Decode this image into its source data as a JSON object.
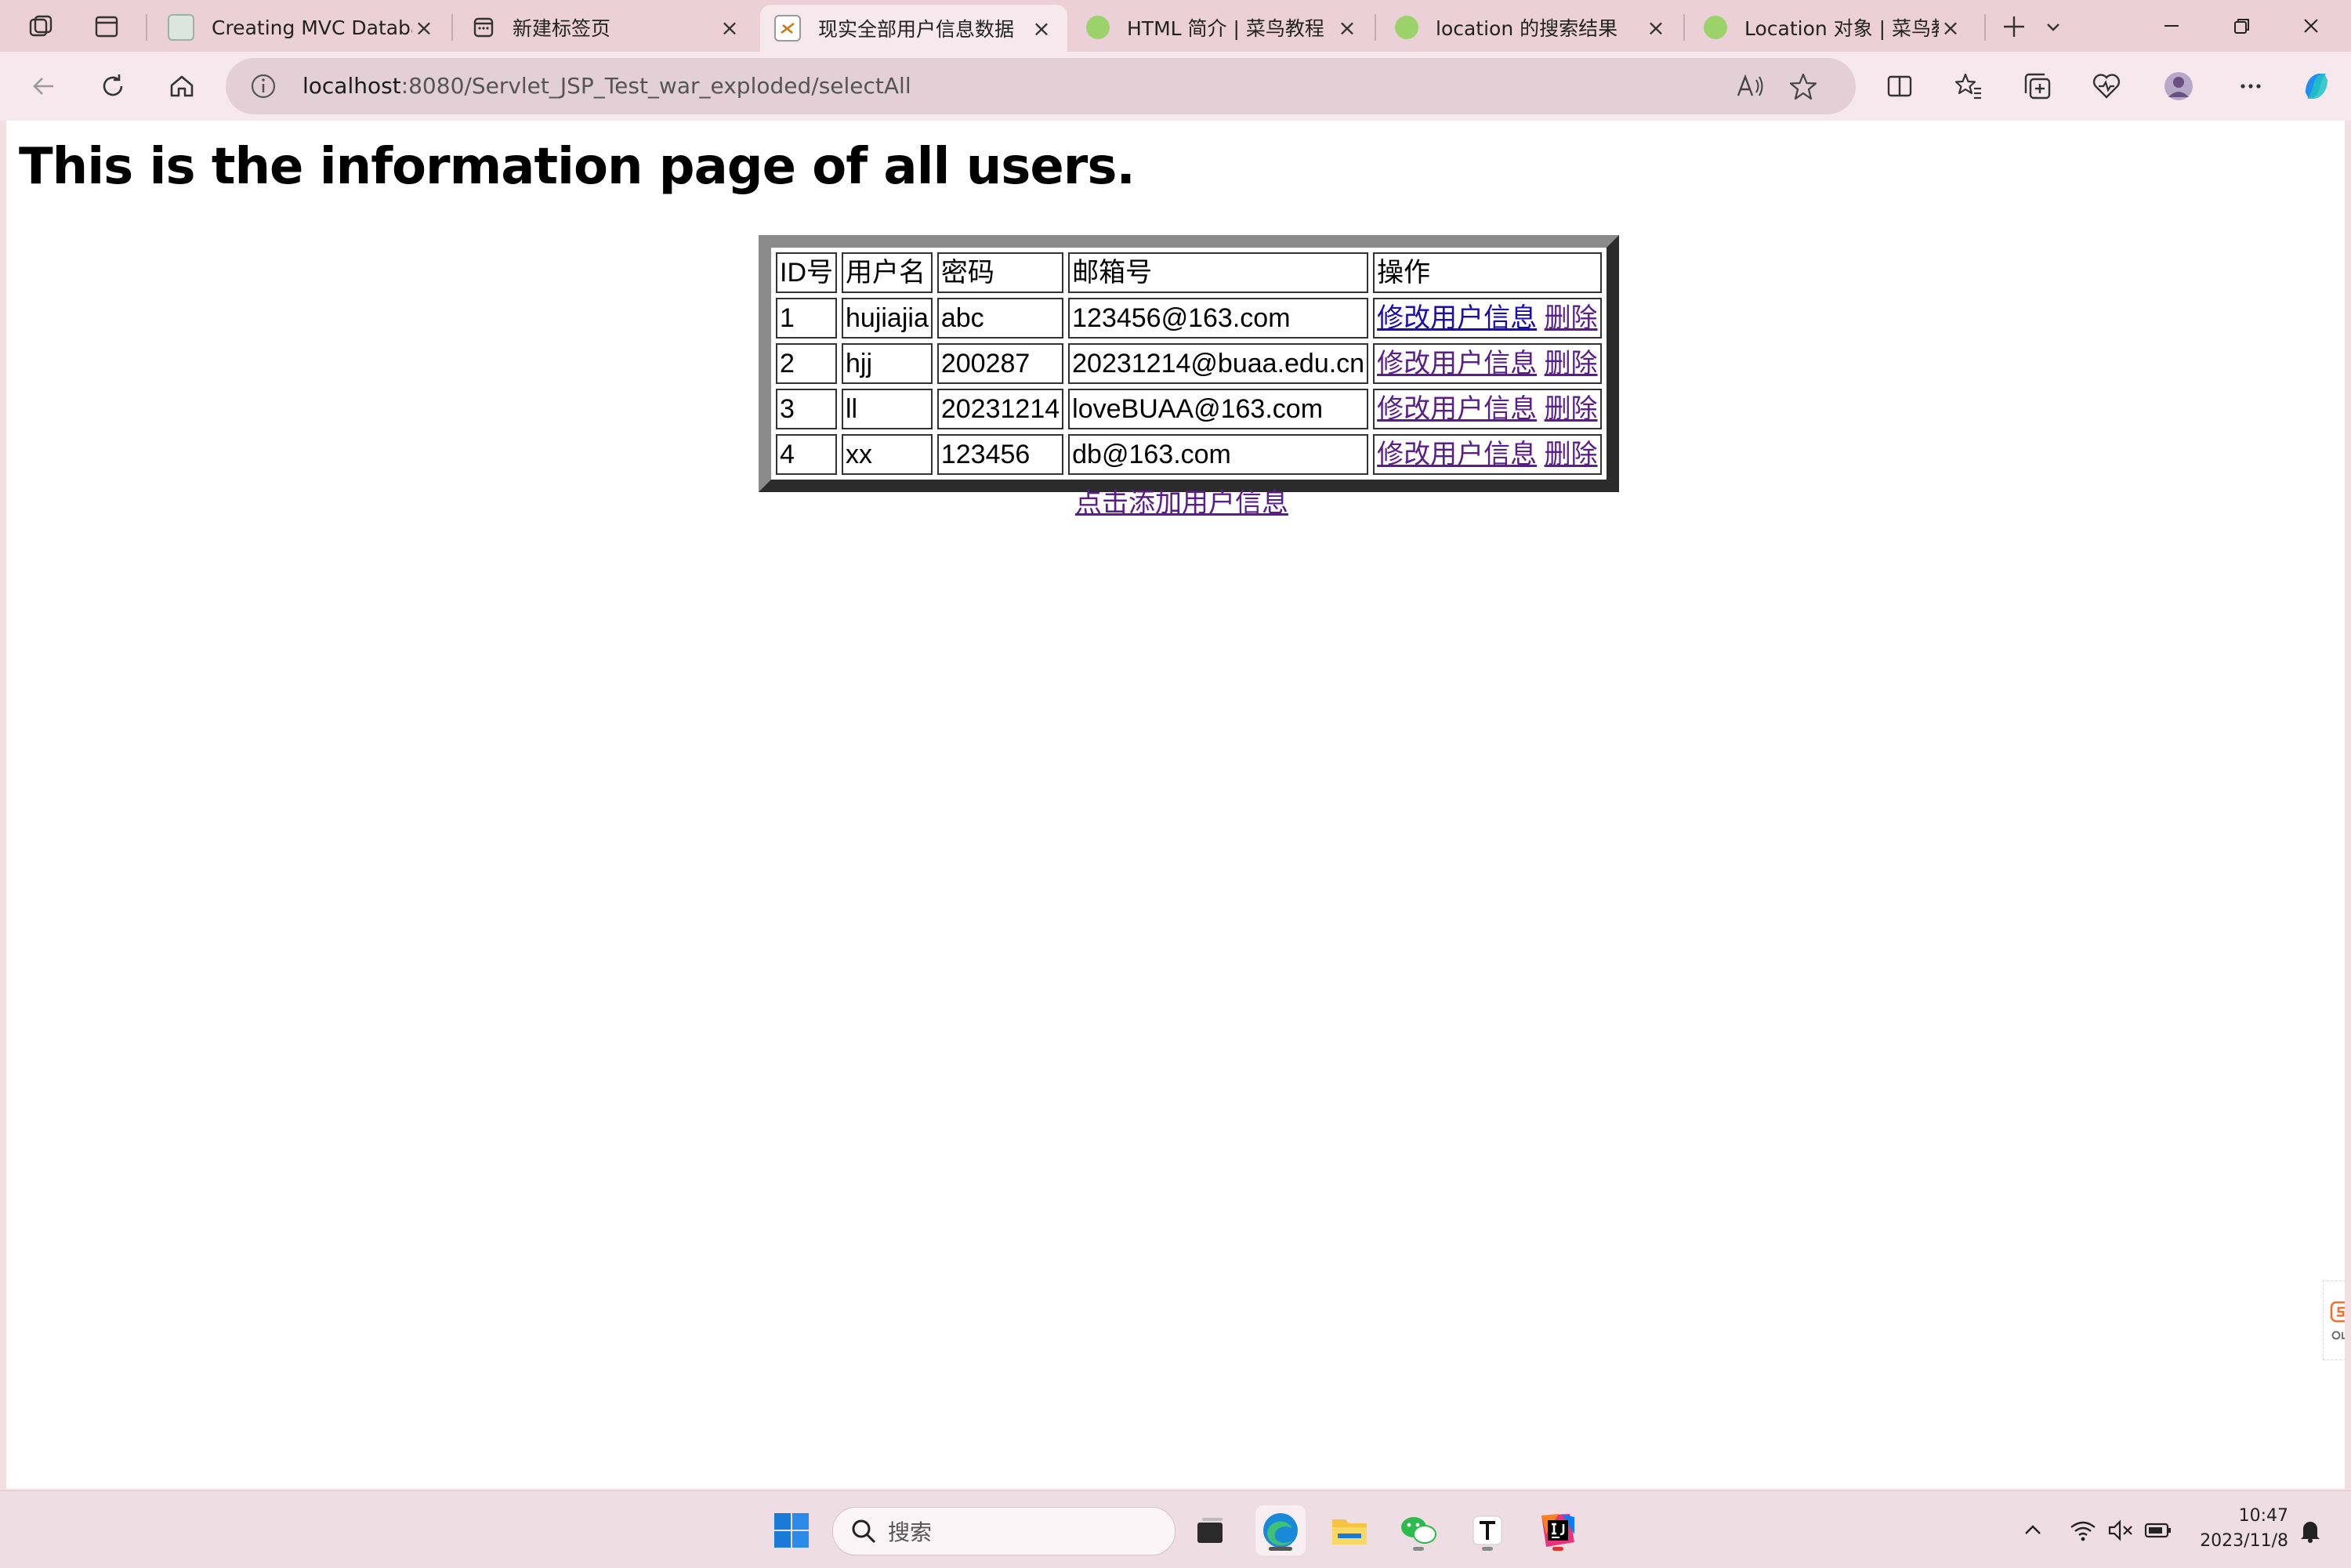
{
  "browser": {
    "tabs": [
      {
        "title": "Creating MVC Database W",
        "favicon": "app-icon"
      },
      {
        "title": "新建标签页",
        "favicon": "newtab-icon"
      },
      {
        "title": "现实全部用户信息数据",
        "favicon": "java-icon",
        "active": true
      },
      {
        "title": "HTML 简介 | 菜鸟教程",
        "favicon": "runoob-icon"
      },
      {
        "title": "location 的搜索结果",
        "favicon": "runoob-icon"
      },
      {
        "title": "Location 对象 | 菜鸟教程",
        "favicon": "runoob-icon"
      }
    ],
    "url_host": "localhost",
    "url_rest": ":8080/Servlet_JSP_Test_war_exploded/selectAll",
    "accent": "#1a0dab"
  },
  "page": {
    "title": "This is the information page of all users.",
    "table": {
      "headers": [
        "ID号",
        "用户名",
        "密码",
        "邮箱号",
        "操作"
      ],
      "rows": [
        {
          "id": "1",
          "username": "hujiajia",
          "password": "abc",
          "email": "123456@163.com"
        },
        {
          "id": "2",
          "username": "hjj",
          "password": "200287",
          "email": "20231214@buaa.edu.cn"
        },
        {
          "id": "3",
          "username": "ll",
          "password": "20231214",
          "email": "loveBUAA@163.com"
        },
        {
          "id": "4",
          "username": "xx",
          "password": "123456",
          "email": "db@163.com"
        }
      ],
      "edit_label": "修改用户信息",
      "delete_label": "删除"
    },
    "add_link": "点击添加用户信息"
  },
  "taskbar": {
    "search_placeholder": "搜索",
    "time": "10:47",
    "date": "2023/11/8"
  }
}
